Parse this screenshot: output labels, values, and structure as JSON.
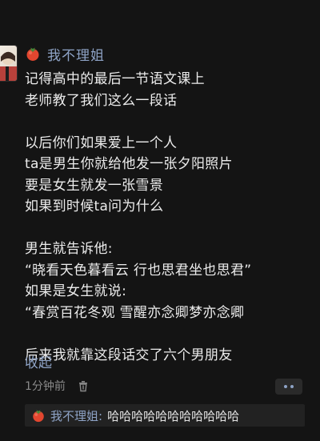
{
  "post": {
    "author": "我不理姐",
    "author_icon": "tomato-icon",
    "lines": [
      "记得高中的最后一节语文课上",
      "老师教了我们这么一段话",
      "",
      "以后你们如果爱上一个人",
      "ta是男生你就给他发一张夕阳照片",
      "要是女生就发一张雪景",
      "如果到时候ta问为什么",
      "",
      "男生就告诉他:",
      "“晓看天色暮看云 行也思君坐也思君”",
      "如果是女生就说:",
      "“春赏百花冬观 雪醒亦念卿梦亦念卿",
      "",
      "后来我就靠这段话交了六个男朋友"
    ],
    "collapse_label": "收起",
    "timestamp": "1分钟前"
  },
  "comment": {
    "author": "我不理姐:",
    "text": "哈哈哈哈哈哈哈哈哈哈哈"
  },
  "colors": {
    "background": "#141414",
    "link": "#8ea3c6",
    "text": "#ececec",
    "muted": "#8a8a8a",
    "comment_bg": "#222222"
  }
}
